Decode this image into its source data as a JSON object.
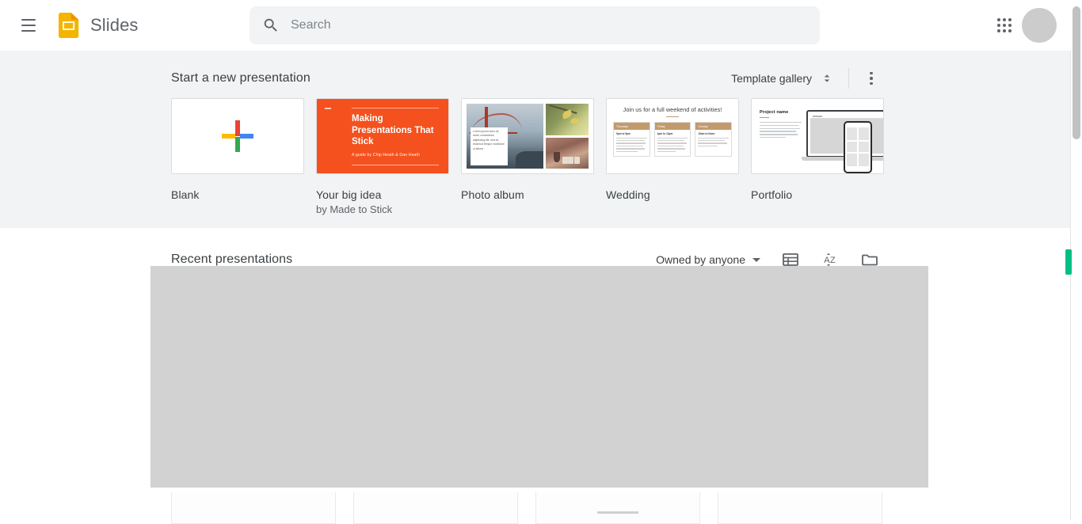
{
  "header": {
    "menu_icon": "hamburger-menu-icon",
    "logo_icon": "google-slides-logo-icon",
    "brand": "Slides",
    "search": {
      "icon": "search-icon",
      "placeholder": "Search",
      "value": ""
    },
    "apps_icon": "apps-grid-icon",
    "avatar": "user-avatar"
  },
  "templates": {
    "title": "Start a new presentation",
    "gallery_label": "Template gallery",
    "gallery_toggle_icon": "chevron-up-down-icon",
    "more_icon": "more-vert-icon",
    "cards": [
      {
        "label": "Blank",
        "sub": "",
        "thumb": "blank-plus-thumbnail"
      },
      {
        "label": "Your big idea",
        "sub": "by Made to Stick",
        "thumb": "your-big-idea-thumbnail",
        "slide": {
          "title": "Making Presentations That Stick",
          "subtitle": "A guide by Chip Heath & Dan Heath"
        }
      },
      {
        "label": "Photo album",
        "sub": "",
        "thumb": "photo-album-thumbnail",
        "slide": {
          "caption": "Lorem ipsum dolor sit amet, consectetur adipiscing elit, sed do eiusmod tempor incididunt ut labore"
        }
      },
      {
        "label": "Wedding",
        "sub": "",
        "thumb": "wedding-thumbnail",
        "slide": {
          "heading": "Join us for a full weekend of activities!",
          "columns": [
            {
              "day": "Thursday",
              "time": "5pm to 9pm"
            },
            {
              "day": "Friday",
              "time": "4pm to 10pm"
            },
            {
              "day": "Sunday",
              "time": "10am to Noon"
            }
          ]
        }
      },
      {
        "label": "Portfolio",
        "sub": "",
        "thumb": "portfolio-thumbnail",
        "slide": {
          "title": "Project name"
        }
      }
    ]
  },
  "recent": {
    "title": "Recent presentations",
    "owner_filter": "Owned by anyone",
    "owner_caret_icon": "caret-down-icon",
    "view_icon": "list-view-icon",
    "sort_icon": "sort-az-icon",
    "folder_icon": "folder-icon",
    "loading_placeholder": "presentation-grid-loading"
  },
  "colors": {
    "brand_yellow": "#f4b400",
    "accent_teal": "#00bf87",
    "section_bg": "#f1f3f4",
    "placeholder_gray": "#d2d2d2",
    "template_orange": "#f4511e",
    "wedding_tan": "#c49a6c"
  }
}
